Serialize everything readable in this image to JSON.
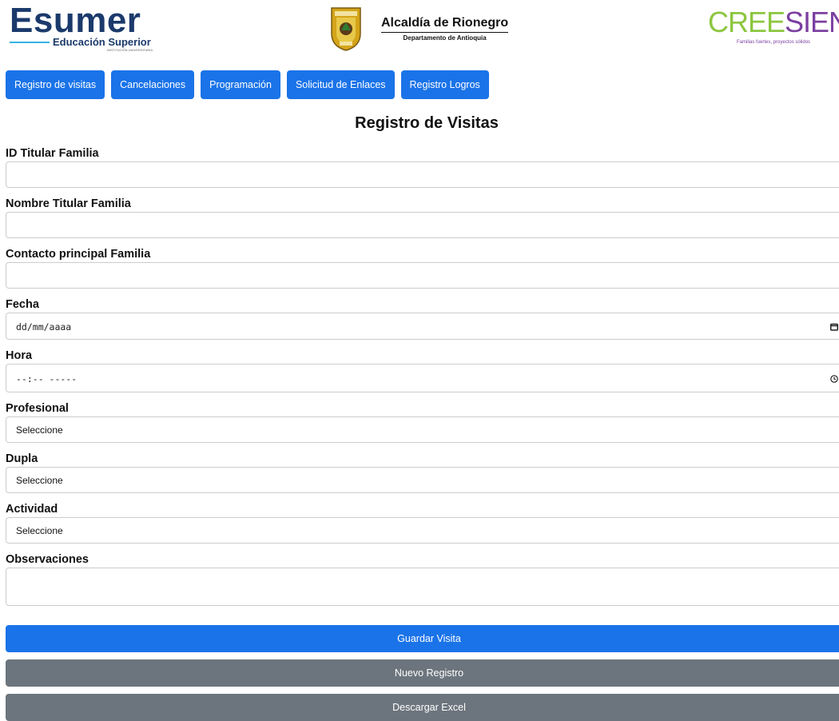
{
  "header": {
    "esumer": {
      "name": "Esumer",
      "subtitle": "Educación Superior",
      "tiny": "INSTITUCIÓN UNIVERSITARIA"
    },
    "rionegro": {
      "title": "Alcaldía de Rionegro",
      "subtitle": "Departamento de Antioquia"
    },
    "cree": {
      "part1": "CREE",
      "part2": "SIEND",
      "tagline": "Familias fuertes, proyectos sólidos"
    }
  },
  "nav": [
    "Registro de visitas",
    "Cancelaciones",
    "Programación",
    "Solicitud de Enlaces",
    "Registro Logros"
  ],
  "page_title": "Registro de Visitas",
  "form": {
    "id_label": "ID Titular Familia",
    "nombre_label": "Nombre Titular Familia",
    "contacto_label": "Contacto principal Familia",
    "fecha_label": "Fecha",
    "fecha_value": "dd/mm/aaaa",
    "hora_label": "Hora",
    "hora_value": "--:-- -----",
    "profesional_label": "Profesional",
    "profesional_value": "Seleccione",
    "dupla_label": "Dupla",
    "dupla_value": "Seleccione",
    "actividad_label": "Actividad",
    "actividad_value": "Seleccione",
    "observaciones_label": "Observaciones"
  },
  "buttons": {
    "guardar": "Guardar Visita",
    "nuevo": "Nuevo Registro",
    "descargar": "Descargar Excel"
  },
  "icons": {
    "fecha": "calendar-icon",
    "hora": "clock-icon",
    "select": "chevron-down-icon"
  },
  "colors": {
    "primary": "#1a73e8",
    "secondary": "#6c757d",
    "esumer_blue": "#1b3a6b",
    "cree_green": "#8cc63f",
    "cree_purple": "#7b3fa0"
  }
}
